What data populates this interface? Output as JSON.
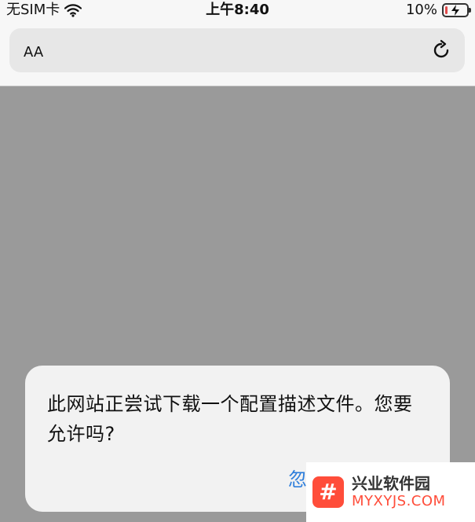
{
  "status_bar": {
    "carrier": "无SIM卡",
    "time": "上午8:40",
    "battery_percent": "10%",
    "battery_level_fraction": 0.1,
    "battery_color": "#e24b4b"
  },
  "url_bar": {
    "text_size_button": "AA",
    "reload_icon": "reload-icon"
  },
  "alert": {
    "message": "此网站正尝试下载一个配置描述文件。您要允许吗?",
    "action_partial": "忽"
  },
  "watermark": {
    "logo_glyph": "#",
    "title": "兴业软件园",
    "site": "MYXYJS.COM",
    "brand_color": "#ff4d3a"
  }
}
